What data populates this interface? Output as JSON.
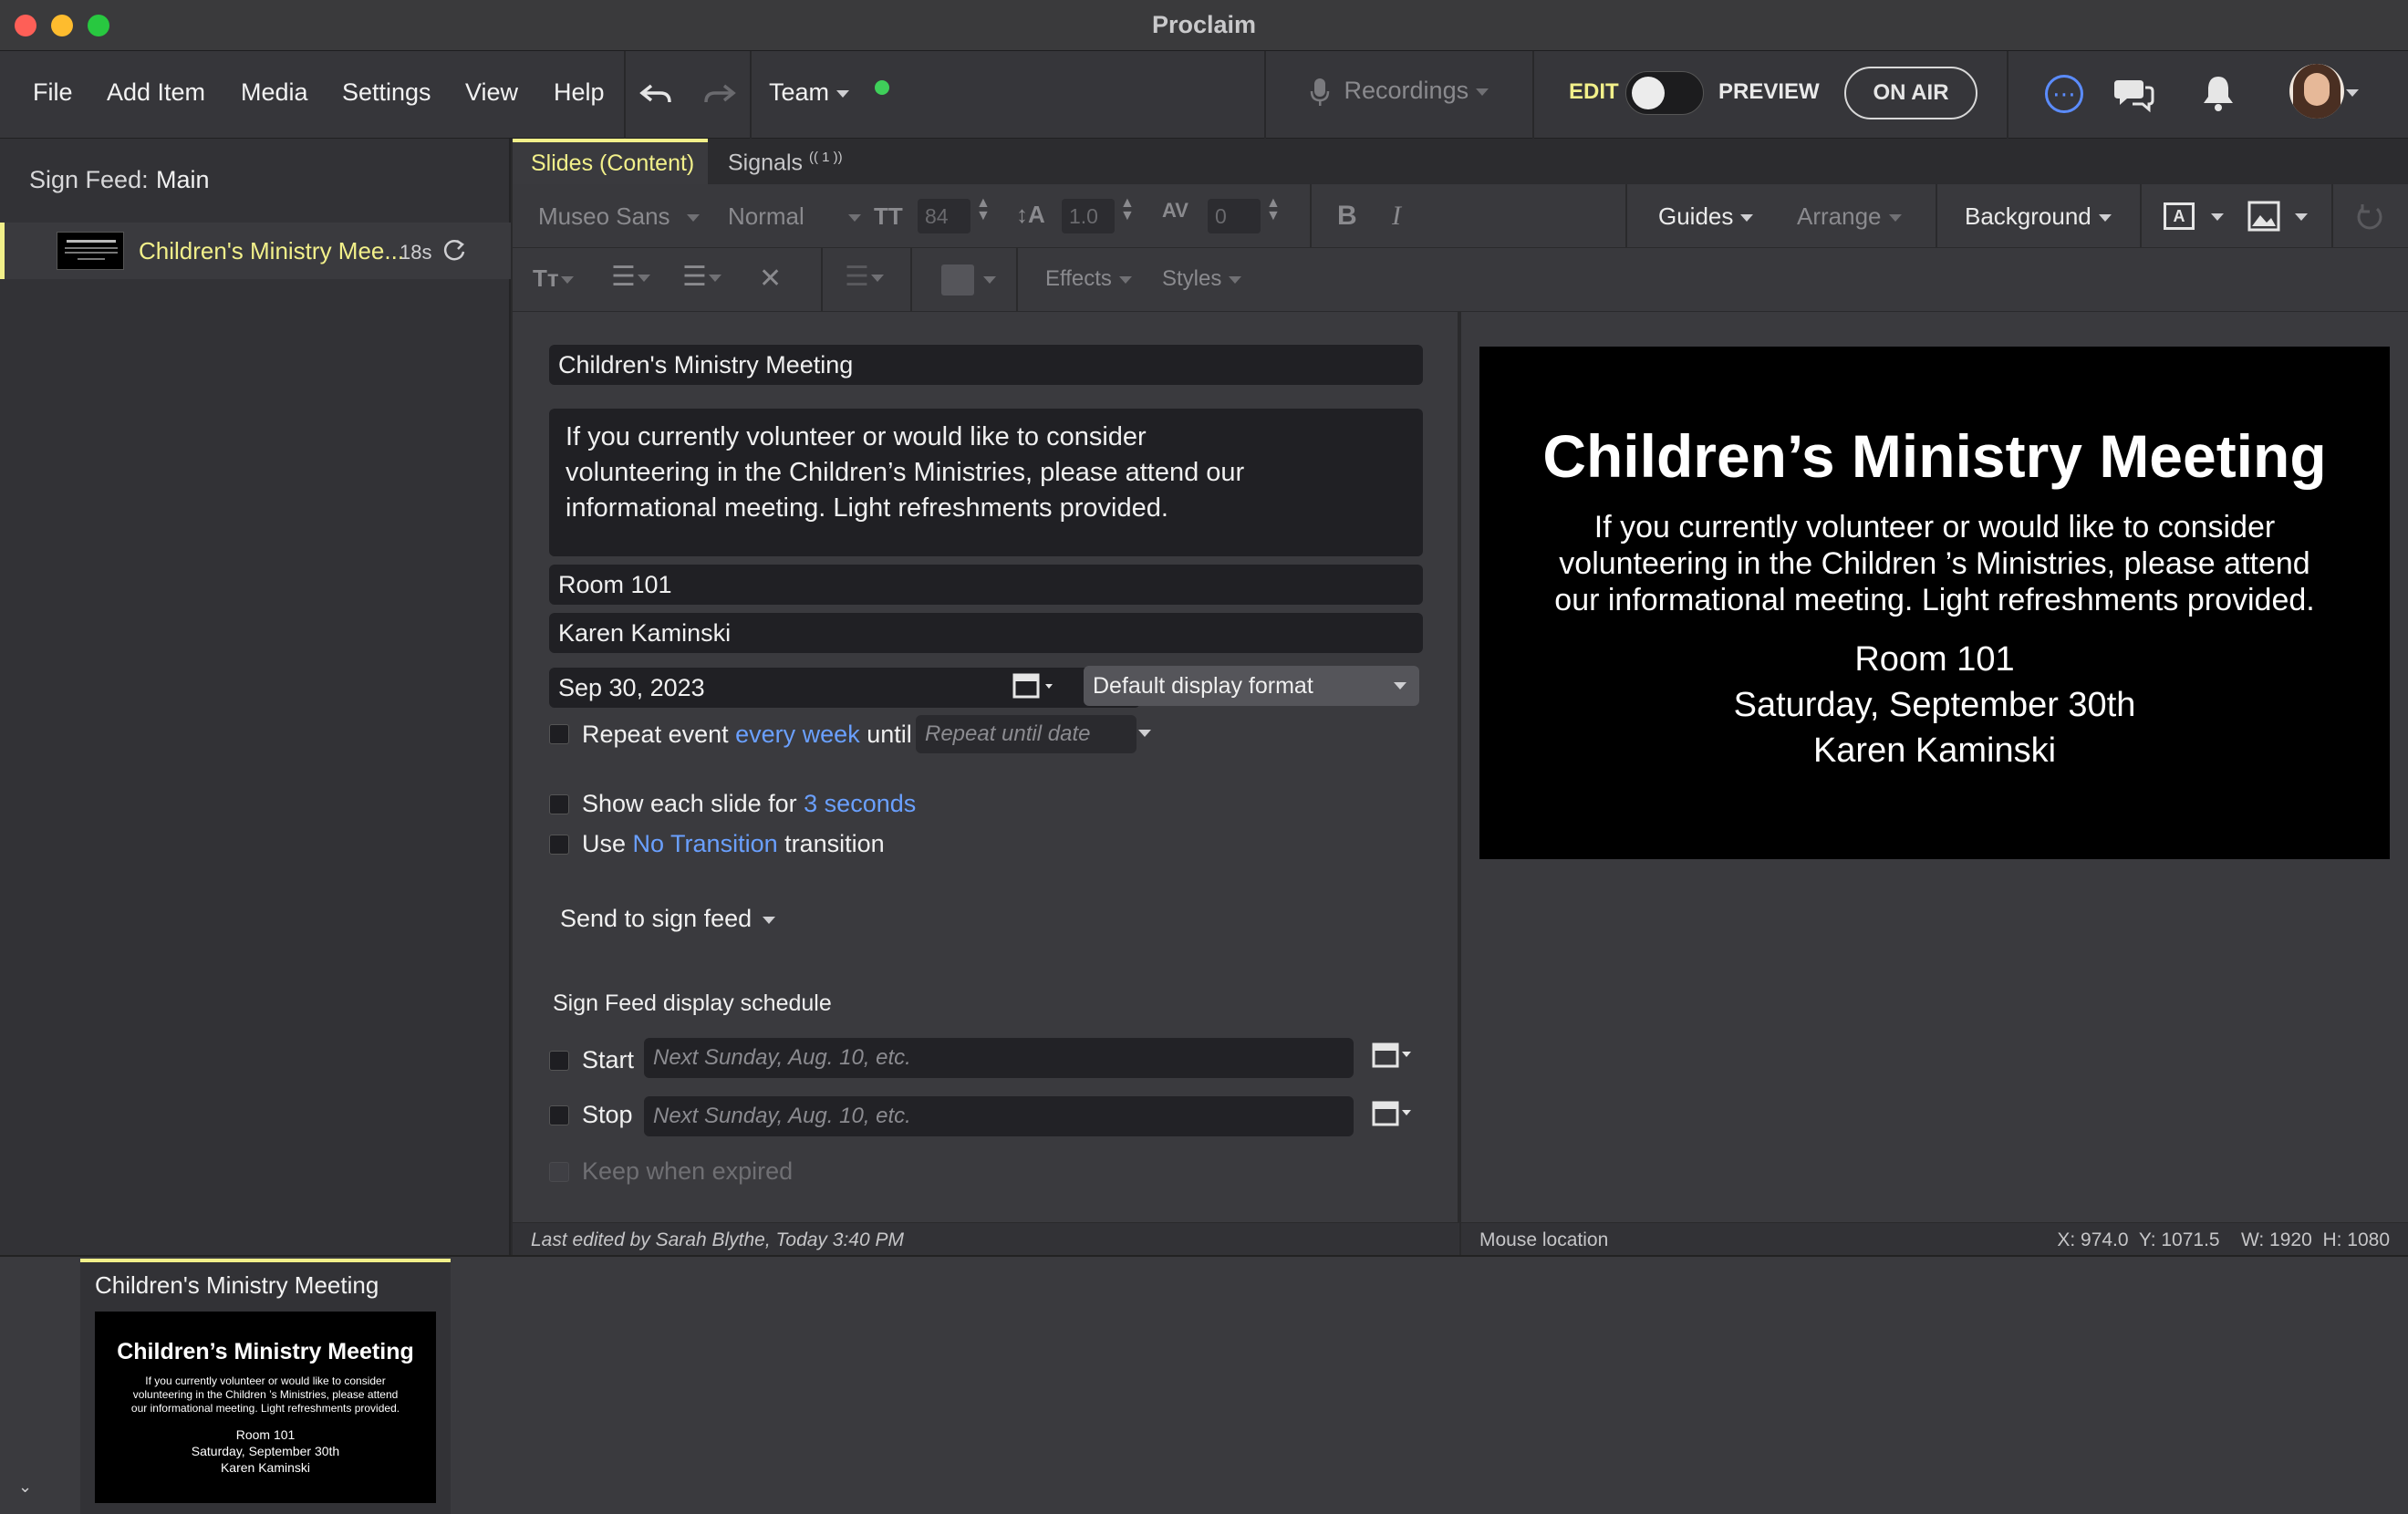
{
  "window": {
    "title": "Proclaim"
  },
  "menu": {
    "items": [
      "File",
      "Add Item",
      "Media",
      "Settings",
      "View",
      "Help"
    ],
    "team_label": "Team",
    "recordings_label": "Recordings",
    "edit_label": "EDIT",
    "preview_label": "PREVIEW",
    "on_air_label": "ON AIR"
  },
  "sidebar": {
    "sign_feed_label": "Sign Feed:",
    "sign_feed_value": "Main",
    "item_title": "Children's Ministry Mee...",
    "item_duration": "18s"
  },
  "tabs": {
    "content": "Slides (Content)",
    "signals": "Signals",
    "signals_badge": "(( 1 ))"
  },
  "toolbar": {
    "font": "Museo Sans",
    "weight": "Normal",
    "size": "84",
    "line_height": "1.0",
    "spacing": "0",
    "bold": "B",
    "italic": "I",
    "guides": "Guides",
    "arrange": "Arrange",
    "background": "Background",
    "effects": "Effects",
    "styles": "Styles"
  },
  "form": {
    "title": "Children's Ministry Meeting",
    "body": "If you currently volunteer or would like to consider volunteering in the Children’s Ministries, please attend our informational meeting. Light refreshments provided.",
    "location": "Room 101",
    "contact": "Karen Kaminski",
    "date": "Sep 30, 2023",
    "display_format": "Default display format",
    "repeat_label": "Repeat event",
    "repeat_link": "every week",
    "repeat_until": "until",
    "repeat_placeholder": "Repeat until date",
    "show_each_prefix": "Show each slide for",
    "show_each_link": "3 seconds",
    "use_label": "Use",
    "transition_link": "No Transition",
    "transition_suffix": "transition",
    "send_to": "Send to sign feed",
    "schedule_heading": "Sign Feed display schedule",
    "start_label": "Start",
    "start_placeholder": "Next Sunday, Aug. 10, etc.",
    "stop_label": "Stop",
    "stop_placeholder": "Next Sunday, Aug. 10, etc.",
    "keep_label": "Keep when expired"
  },
  "slide": {
    "title": "Children’s Ministry Meeting",
    "body_line1": "If you currently volunteer or would like to consider",
    "body_line2": "volunteering in the Children ’s Ministries, please attend",
    "body_line3": "our informational meeting. Light refreshments provided.",
    "room": "Room 101",
    "date": "Saturday, September 30th",
    "contact": "Karen Kaminski"
  },
  "status": {
    "last_edited": "Last edited by Sarah Blythe, Today 3:40 PM",
    "mouse_label": "Mouse location",
    "coords": "X: 974.0  Y: 1071.5    W: 1920  H: 1080"
  },
  "bottom": {
    "card_title": "Children's Ministry Meeting"
  },
  "colors": {
    "accent": "#f2f08a",
    "link": "#6aa0ff",
    "status_dot": "#3fcf5a",
    "info": "#5b8cff"
  }
}
